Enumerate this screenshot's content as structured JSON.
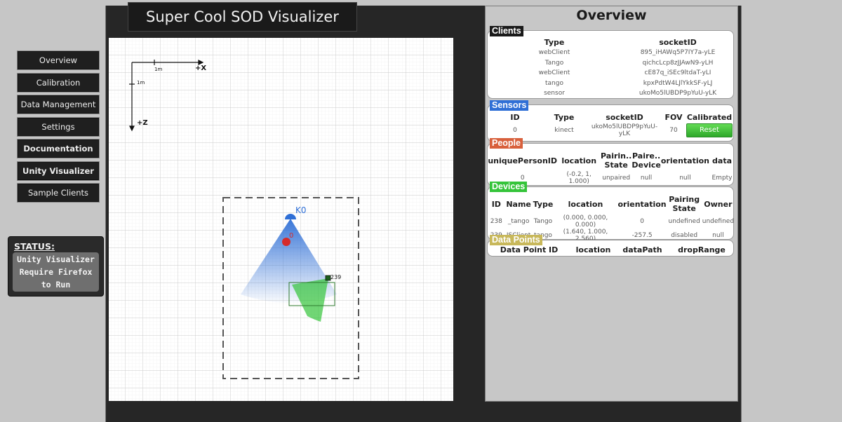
{
  "app": {
    "title": "Super Cool SOD Visualizer"
  },
  "nav": {
    "items": [
      {
        "label": "Overview"
      },
      {
        "label": "Calibration"
      },
      {
        "label": "Data Management"
      },
      {
        "label": "Settings"
      },
      {
        "label": "Documentation"
      },
      {
        "label": "Unity Visualizer"
      },
      {
        "label": "Sample Clients"
      }
    ]
  },
  "status": {
    "label": "STATUS:",
    "lines": [
      "Unity Visualizer",
      "Require Firefox",
      "to Run"
    ]
  },
  "canvas": {
    "axis_x_label": "+X",
    "axis_z_label": "+Z",
    "scale_x_label": "1m",
    "scale_z_label": "1m",
    "sensor_label": "K0",
    "person_label": "0",
    "device_label": "239",
    "colors": {
      "sensor": "#2f6fd6",
      "person": "#d62a2a",
      "device": "#35c43a"
    }
  },
  "overview": {
    "title": "Overview",
    "clients": {
      "tag": "Clients",
      "headers": [
        "Type",
        "socketID"
      ],
      "rows": [
        [
          "webClient",
          "895_iHAWq5P7IY7a-yLE"
        ],
        [
          "Tango",
          "qichcLcp8zJJAwN9-yLH"
        ],
        [
          "webClient",
          "cE87q_iSEc9ltdaT-yLI"
        ],
        [
          "tango",
          "kpxPdtW4LJlYkkSF-yLJ"
        ],
        [
          "sensor",
          "ukoMo5lUBDP9pYuU-yLK"
        ]
      ]
    },
    "sensors": {
      "tag": "Sensors",
      "headers": [
        "ID",
        "Type",
        "socketID",
        "FOV",
        "Calibrated"
      ],
      "rows": [
        [
          "0",
          "kinect",
          "ukoMo5lUBDP9pYuU-yLK",
          "70"
        ]
      ],
      "reset_label": "Reset"
    },
    "people": {
      "tag": "People",
      "headers": [
        "uniquePersonID",
        "location",
        "Pairin.. State",
        "Paire.. Device",
        "orientation",
        "data"
      ],
      "rows": [
        [
          "0",
          "(-0.2, 1, 1.000)",
          "unpaired",
          "null",
          "null",
          "Empty"
        ]
      ]
    },
    "devices": {
      "tag": "Devices",
      "headers": [
        "ID",
        "Name",
        "Type",
        "location",
        "orientation",
        "Pairing State",
        "Owner"
      ],
      "rows": [
        [
          "238",
          "_tango",
          "Tango",
          "(0.000, 0.000, 0.000)",
          "0",
          "undefined",
          "undefined"
        ],
        [
          "239",
          "JSClient",
          "tango",
          "(1.640, 1.000, 2.560)",
          "-257.5",
          "disabled",
          "null"
        ]
      ]
    },
    "datapoints": {
      "tag": "Data Points",
      "headers": [
        "Data Point ID",
        "location",
        "dataPath",
        "dropRange"
      ]
    },
    "tag_colors": {
      "clients": "#1a1a1a",
      "sensors": "#2f6fd6",
      "people": "#d8603c",
      "devices": "#35c43a",
      "datapoints": "#c8b85a"
    }
  }
}
